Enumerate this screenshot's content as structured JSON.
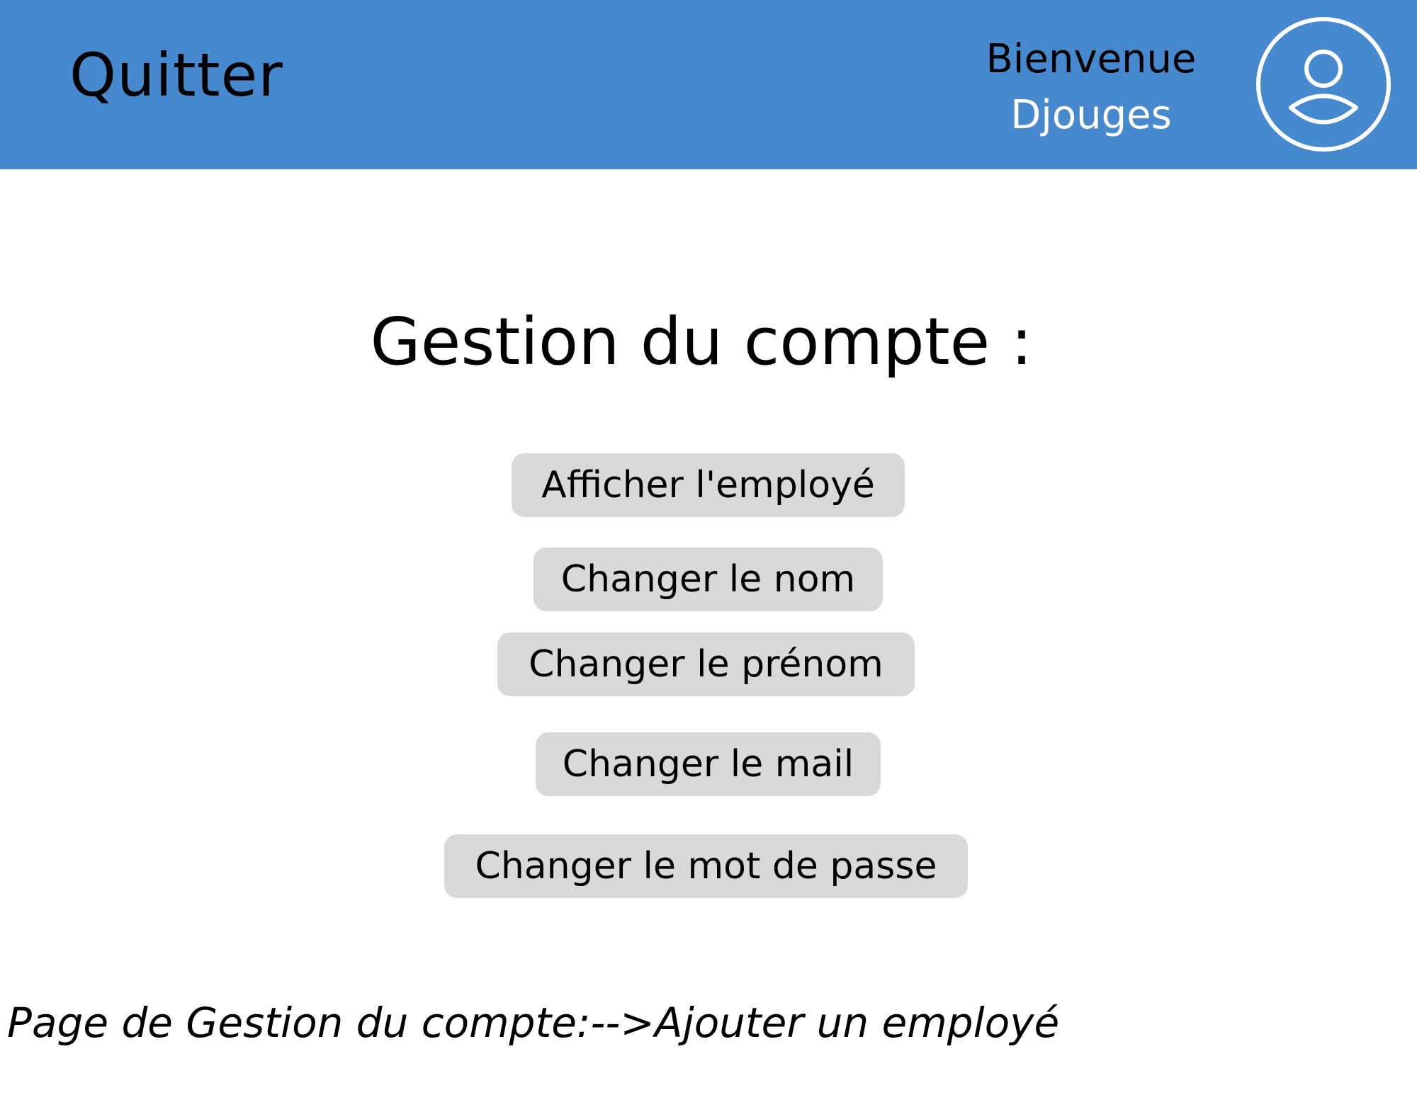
{
  "header": {
    "background_color": "#4789CE",
    "quit_label": "Quitter",
    "welcome_label": "Bienvenue",
    "username": "Djouges",
    "avatar_icon": "user-circle-icon"
  },
  "main": {
    "title": "Gestion du compte :",
    "buttons": [
      {
        "label": "Afficher l'employé"
      },
      {
        "label": "Changer le nom"
      },
      {
        "label": "Changer le prénom"
      },
      {
        "label": "Changer le mail"
      },
      {
        "label": "Changer le mot de passe"
      }
    ],
    "button_color": "#D9D9D9"
  },
  "footer": {
    "caption": "Page de Gestion du compte:-->Ajouter un employé"
  }
}
